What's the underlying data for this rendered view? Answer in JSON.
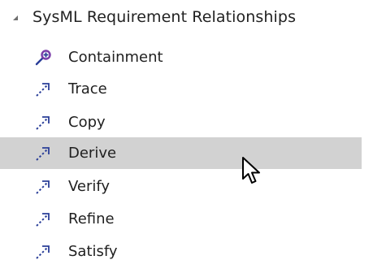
{
  "toolbox": {
    "group": {
      "title": "SysML Requirement Relationships",
      "expanded": true
    },
    "items": [
      {
        "label": "Containment",
        "icon": "containment-icon"
      },
      {
        "label": "Trace",
        "icon": "dashed-arrow-icon"
      },
      {
        "label": "Copy",
        "icon": "dashed-arrow-icon"
      },
      {
        "label": "Derive",
        "icon": "dashed-arrow-icon",
        "selected": true
      },
      {
        "label": "Verify",
        "icon": "dashed-arrow-icon"
      },
      {
        "label": "Refine",
        "icon": "dashed-arrow-icon"
      },
      {
        "label": "Satisfy",
        "icon": "dashed-arrow-icon"
      }
    ]
  },
  "colors": {
    "selected_row": "#d2d2d2",
    "icon_blue": "#2a3e98",
    "icon_purple": "#7a3ca8",
    "text": "#1f1f1f"
  }
}
